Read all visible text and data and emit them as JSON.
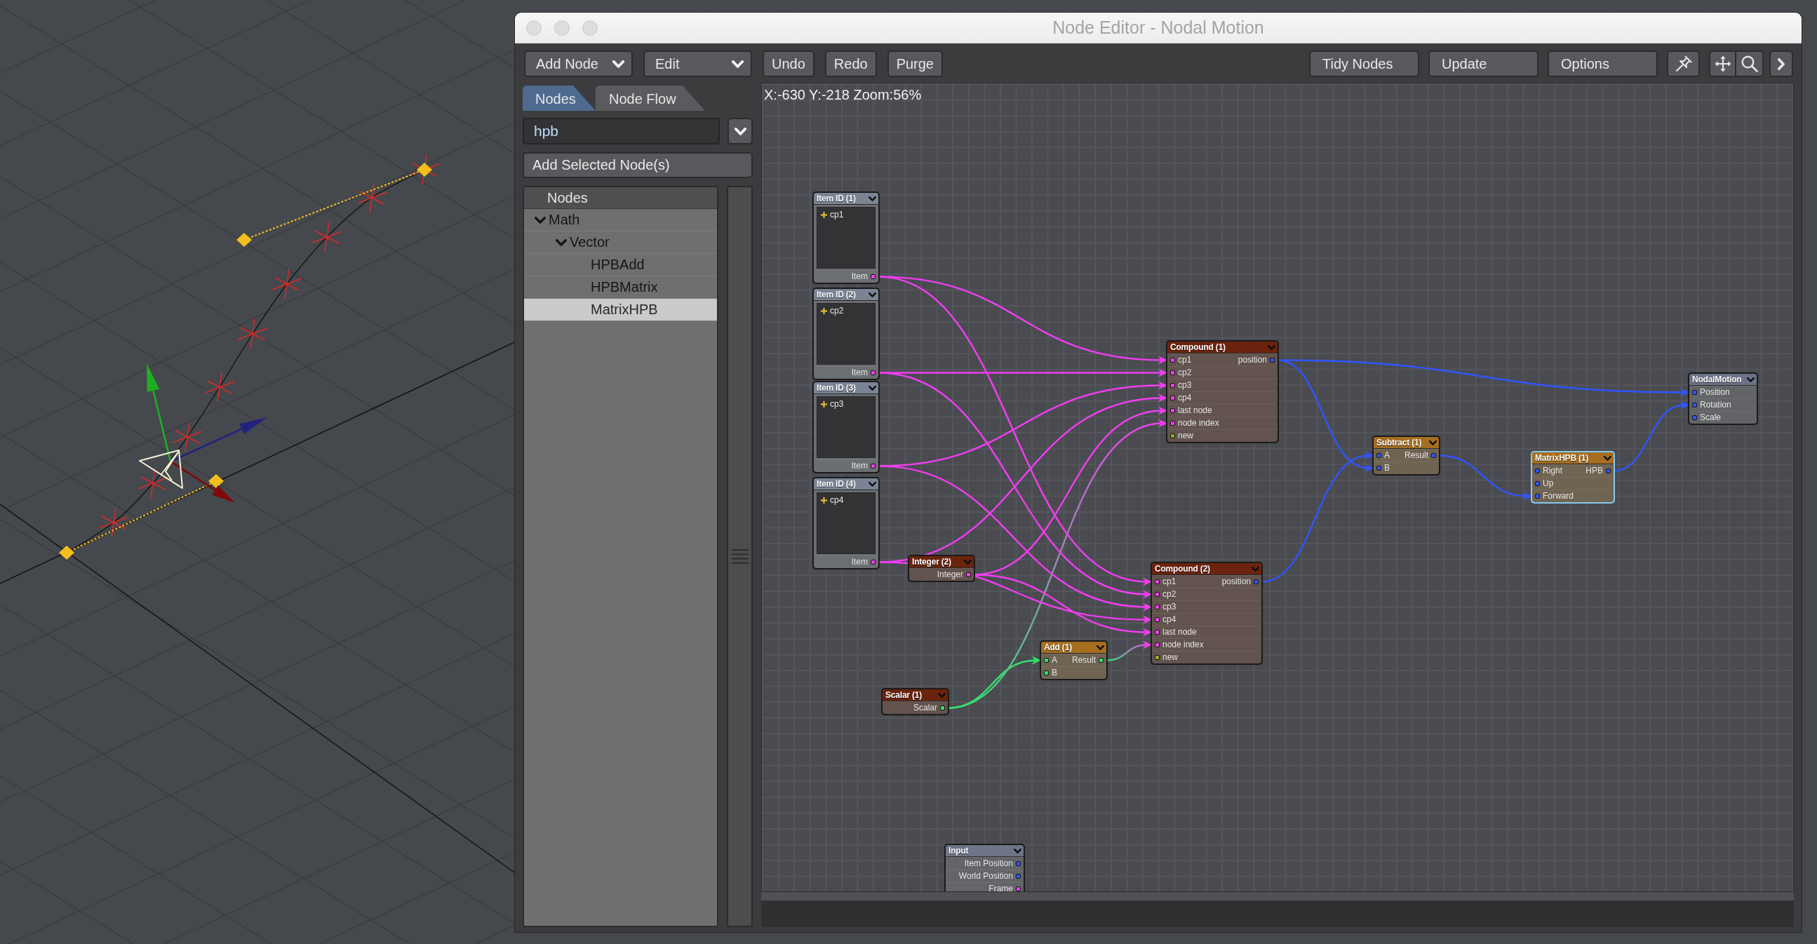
{
  "window": {
    "title": "Node Editor - Nodal Motion"
  },
  "toolbar": {
    "left": [
      {
        "label": "Add Node",
        "kind": "dropdown"
      },
      {
        "label": "Edit",
        "kind": "dropdown"
      },
      {
        "label": "Undo",
        "kind": "button"
      },
      {
        "label": "Redo",
        "kind": "button"
      },
      {
        "label": "Purge",
        "kind": "button"
      }
    ],
    "right": [
      {
        "label": "Tidy Nodes",
        "kind": "button"
      },
      {
        "label": "Update",
        "kind": "button"
      },
      {
        "label": "Options",
        "kind": "button"
      }
    ]
  },
  "library": {
    "tabs": [
      {
        "label": "Nodes",
        "selected": true
      },
      {
        "label": "Node Flow",
        "selected": false
      }
    ],
    "search": {
      "value": "hpb"
    },
    "add_button": "Add Selected Node(s)",
    "tree": {
      "header": "Nodes",
      "items": [
        {
          "label": "Math",
          "expanded": true,
          "selected": false,
          "children": [
            {
              "label": "Vector",
              "expanded": true,
              "selected": false,
              "children": [
                {
                  "label": "HPBAdd",
                  "selected": false
                },
                {
                  "label": "HPBMatrix",
                  "selected": false
                },
                {
                  "label": "MatrixHPB",
                  "selected": true
                }
              ]
            }
          ]
        }
      ]
    }
  },
  "canvas": {
    "status": "X:-630 Y:-218 Zoom:56%",
    "nodes": [
      {
        "title": "Item ID (1)",
        "kind": "item_id",
        "selected": false,
        "item": "cp1",
        "outputs": [
          {
            "label": "Item",
            "kind": "integer"
          }
        ]
      },
      {
        "title": "Item ID (2)",
        "kind": "item_id",
        "selected": false,
        "item": "cp2",
        "outputs": [
          {
            "label": "Item",
            "kind": "integer"
          }
        ]
      },
      {
        "title": "Item ID (3)",
        "kind": "item_id",
        "selected": false,
        "item": "cp3",
        "outputs": [
          {
            "label": "Item",
            "kind": "integer"
          }
        ]
      },
      {
        "title": "Item ID (4)",
        "kind": "item_id",
        "selected": false,
        "item": "cp4",
        "outputs": [
          {
            "label": "Item",
            "kind": "integer"
          }
        ]
      },
      {
        "title": "Integer (2)",
        "kind": "constant",
        "selected": false,
        "outputs": [
          {
            "label": "Integer",
            "kind": "integer"
          }
        ]
      },
      {
        "title": "Scalar (1)",
        "kind": "constant",
        "selected": false,
        "outputs": [
          {
            "label": "Scalar",
            "kind": "scalar"
          }
        ]
      },
      {
        "title": "Input",
        "kind": "input",
        "selected": false,
        "outputs": [
          {
            "label": "Item Position",
            "kind": "vector"
          },
          {
            "label": "World Position",
            "kind": "vector"
          },
          {
            "label": "Frame",
            "kind": "integer"
          }
        ]
      },
      {
        "title": "Add (1)",
        "kind": "math",
        "selected": false,
        "inputs": [
          {
            "label": "A",
            "kind": "scalar",
            "connected": true
          },
          {
            "label": "B",
            "kind": "scalar",
            "connected": false
          }
        ],
        "outputs": [
          {
            "label": "Result",
            "kind": "scalar"
          }
        ]
      },
      {
        "title": "Compound (1)",
        "kind": "compound",
        "selected": false,
        "inputs": [
          {
            "label": "cp1",
            "kind": "integer",
            "connected": true
          },
          {
            "label": "cp2",
            "kind": "integer",
            "connected": true
          },
          {
            "label": "cp3",
            "kind": "integer",
            "connected": true
          },
          {
            "label": "cp4",
            "kind": "integer",
            "connected": true
          },
          {
            "label": "last node",
            "kind": "integer",
            "connected": true
          },
          {
            "label": "node index",
            "kind": "integer",
            "connected": true
          },
          {
            "label": "new",
            "kind": "boolean",
            "connected": false
          }
        ],
        "outputs": [
          {
            "label": "position",
            "kind": "vector"
          }
        ]
      },
      {
        "title": "Compound (2)",
        "kind": "compound",
        "selected": false,
        "inputs": [
          {
            "label": "cp1",
            "kind": "integer",
            "connected": true
          },
          {
            "label": "cp2",
            "kind": "integer",
            "connected": true
          },
          {
            "label": "cp3",
            "kind": "integer",
            "connected": true
          },
          {
            "label": "cp4",
            "kind": "integer",
            "connected": true
          },
          {
            "label": "last node",
            "kind": "integer",
            "connected": true
          },
          {
            "label": "node index",
            "kind": "integer",
            "connected": true
          },
          {
            "label": "new",
            "kind": "boolean",
            "connected": false
          }
        ],
        "outputs": [
          {
            "label": "position",
            "kind": "vector"
          }
        ]
      },
      {
        "title": "Subtract (1)",
        "kind": "math",
        "selected": false,
        "inputs": [
          {
            "label": "A",
            "kind": "vector",
            "connected": true
          },
          {
            "label": "B",
            "kind": "vector",
            "connected": true
          }
        ],
        "outputs": [
          {
            "label": "Result",
            "kind": "vector"
          }
        ]
      },
      {
        "title": "MatrixHPB (1)",
        "kind": "math",
        "selected": true,
        "inputs": [
          {
            "label": "Right",
            "kind": "vector",
            "connected": false
          },
          {
            "label": "Up",
            "kind": "vector",
            "connected": false
          },
          {
            "label": "Forward",
            "kind": "vector",
            "connected": true
          }
        ],
        "outputs": [
          {
            "label": "HPB",
            "kind": "vector"
          }
        ]
      },
      {
        "title": "NodalMotion",
        "kind": "output",
        "selected": false,
        "inputs": [
          {
            "label": "Position",
            "kind": "vector",
            "connected": true
          },
          {
            "label": "Rotation",
            "kind": "vector",
            "connected": true
          },
          {
            "label": "Scale",
            "kind": "vector",
            "connected": false
          }
        ]
      }
    ]
  }
}
